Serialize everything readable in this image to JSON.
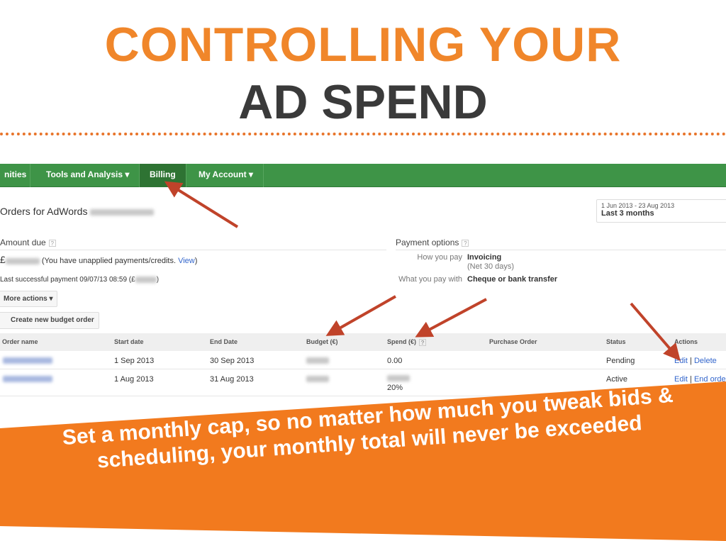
{
  "slide": {
    "title_line1": "CONTROLLING YOUR",
    "title_line2": "AD SPEND",
    "banner": "Set a monthly cap, so no matter how much you tweak bids & scheduling, your monthly total will never be exceeded",
    "accent": "#f0862a",
    "arrow_color": "#c0432a"
  },
  "nav": {
    "items": [
      {
        "label": "nities"
      },
      {
        "label": "Tools and Analysis ▾"
      },
      {
        "label": "Billing",
        "active": true
      },
      {
        "label": "My Account ▾"
      }
    ],
    "color": "#3e9447"
  },
  "page": {
    "title": "Orders for AdWords",
    "date_range": "1 Jun 2013 - 23 Aug 2013",
    "date_label": "Last 3 months"
  },
  "amount": {
    "heading": "Amount due",
    "currency": "£",
    "note": "(You have unapplied payments/credits.",
    "view": "View",
    "close": ")",
    "last_payment": "Last successful payment 09/07/13 08:59 (£"
  },
  "payment": {
    "heading": "Payment options",
    "how_label": "How you pay",
    "how_value": "Invoicing",
    "how_sub": "(Net 30 days)",
    "with_label": "What you pay with",
    "with_value": "Cheque or bank transfer"
  },
  "buttons": {
    "more_actions": "More actions ▾",
    "create": "Create new budget order"
  },
  "table": {
    "headers": [
      "Order name",
      "Start date",
      "End Date",
      "Budget (€)",
      "Spend (€)",
      "Purchase Order",
      "Status",
      "Actions"
    ],
    "rows": [
      {
        "start": "1 Sep 2013",
        "end": "30 Sep 2013",
        "spend": "0.00",
        "spend_pct": "",
        "status": "Pending",
        "action1": "Edit",
        "action2": "Delete"
      },
      {
        "start": "1 Aug 2013",
        "end": "31 Aug 2013",
        "spend": "",
        "spend_pct": "20%",
        "status": "Active",
        "action1": "Edit",
        "action2": "End order"
      }
    ]
  }
}
